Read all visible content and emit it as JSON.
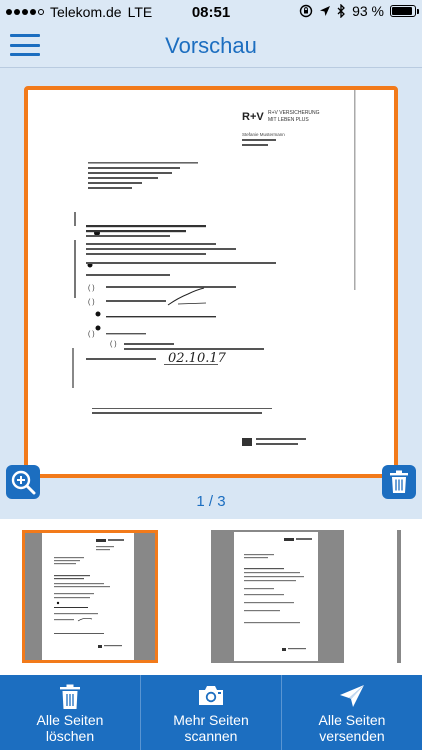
{
  "status_bar": {
    "carrier": "Telekom.de",
    "network": "LTE",
    "time": "08:51",
    "battery": "93 %",
    "battery_level": 0.93
  },
  "nav": {
    "title": "Vorschau"
  },
  "preview": {
    "page_indicator": "1 / 3",
    "document": {
      "brand": "R+V",
      "brand_line1": "R+V VERSICHERUNG",
      "brand_line2": "MIT LEBEN PLUS",
      "recipient_name": "Stefanie Mustermann",
      "handwritten_date": "02.10.17"
    }
  },
  "toolbar": {
    "delete_all_line1": "Alle Seiten",
    "delete_all_line2": "löschen",
    "scan_more_line1": "Mehr Seiten",
    "scan_more_line2": "scannen",
    "send_all_line1": "Alle Seiten",
    "send_all_line2": "versenden"
  },
  "colors": {
    "accent": "#1c6ec0",
    "selection": "#f27a1a",
    "background": "#d8e6f4"
  },
  "icons": [
    "menu-icon",
    "zoom-in-icon",
    "trash-icon",
    "camera-icon",
    "send-icon"
  ]
}
